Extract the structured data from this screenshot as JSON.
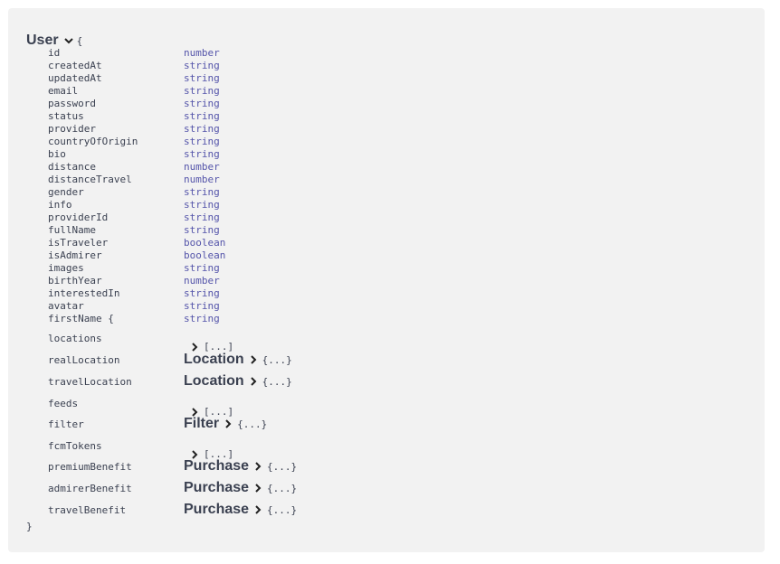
{
  "model": {
    "title": "User",
    "open_brace": "{",
    "close_brace": "}"
  },
  "scalar_properties": [
    {
      "name": "id",
      "type": "number"
    },
    {
      "name": "createdAt",
      "type": "string"
    },
    {
      "name": "updatedAt",
      "type": "string"
    },
    {
      "name": "email",
      "type": "string"
    },
    {
      "name": "password",
      "type": "string"
    },
    {
      "name": "status",
      "type": "string"
    },
    {
      "name": "provider",
      "type": "string"
    },
    {
      "name": "countryOfOrigin",
      "type": "string"
    },
    {
      "name": "bio",
      "type": "string"
    },
    {
      "name": "distance",
      "type": "number"
    },
    {
      "name": "distanceTravel",
      "type": "number"
    },
    {
      "name": "gender",
      "type": "string"
    },
    {
      "name": "info",
      "type": "string"
    },
    {
      "name": "providerId",
      "type": "string"
    },
    {
      "name": "fullName",
      "type": "string"
    },
    {
      "name": "isTraveler",
      "type": "boolean"
    },
    {
      "name": "isAdmirer",
      "type": "boolean"
    },
    {
      "name": "images",
      "type": "string"
    },
    {
      "name": "birthYear",
      "type": "number"
    },
    {
      "name": "interestedIn",
      "type": "string"
    },
    {
      "name": "avatar",
      "type": "string"
    },
    {
      "name": "firstName {",
      "type": "string"
    }
  ],
  "complex_properties": [
    {
      "name": "locations",
      "kind": "array",
      "collapsed": "[...]"
    },
    {
      "name": "realLocation",
      "kind": "object",
      "ref": "Location",
      "collapsed": "{...}"
    },
    {
      "name": "travelLocation",
      "kind": "object",
      "ref": "Location",
      "collapsed": "{...}"
    },
    {
      "name": "feeds",
      "kind": "array",
      "collapsed": "[...]"
    },
    {
      "name": "filter",
      "kind": "object",
      "ref": "Filter",
      "collapsed": "{...}"
    },
    {
      "name": "fcmTokens",
      "kind": "array",
      "collapsed": "[...]"
    },
    {
      "name": "premiumBenefit",
      "kind": "object",
      "ref": "Purchase",
      "collapsed": "{...}"
    },
    {
      "name": "admirerBenefit",
      "kind": "object",
      "ref": "Purchase",
      "collapsed": "{...}"
    },
    {
      "name": "travelBenefit",
      "kind": "object",
      "ref": "Purchase",
      "collapsed": "{...}"
    }
  ],
  "colors": {
    "panel_bg": "#f2f2f2",
    "text": "#3b4151",
    "type_text": "#55a"
  },
  "icons": {
    "expand": "chevron-down-icon",
    "collapsed": "chevron-right-icon"
  }
}
